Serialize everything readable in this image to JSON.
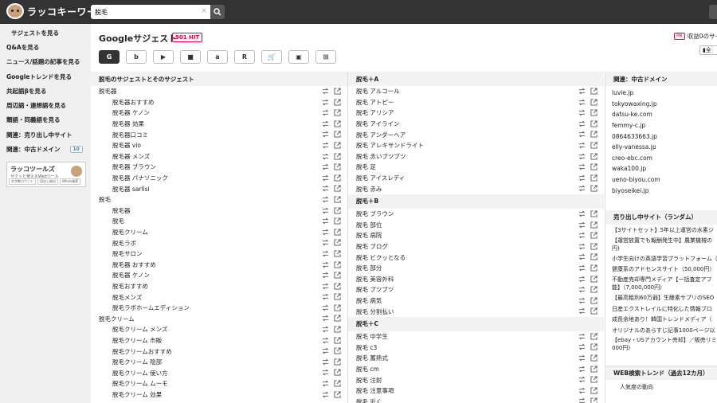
{
  "app": {
    "logo_text": "ラッコキーワード"
  },
  "search": {
    "value": "脱毛",
    "clear": "×"
  },
  "sidebar": {
    "items": [
      "サジェストを見る",
      "Q&Aを見る",
      "ニュース/話題の記事を見る",
      "Googleトレンドを見る",
      "共起語βを見る",
      "周辺語・連想語を見る",
      "類語・同義語を見る",
      "関連：売り出し中サイト",
      "関連：中古ドメイン"
    ],
    "domain_badge": "10",
    "banner": {
      "title": "ラッコツールズ",
      "sub": "サクッと使えるWebツール",
      "tags": [
        "文字数カウント",
        "見出し抽出",
        "Whois検索"
      ]
    }
  },
  "main": {
    "title": "Googleサジェスト",
    "hit": "901 HIT",
    "pr": "PR",
    "revenue": "収益0のサイ",
    "copy": "全"
  },
  "engines": [
    {
      "label": "G",
      "icon": "google-icon"
    },
    {
      "label": "b",
      "icon": "bing-icon"
    },
    {
      "label": "▶",
      "icon": "youtube-icon"
    },
    {
      "label": "■",
      "icon": "video-icon"
    },
    {
      "label": "a",
      "icon": "amazon-icon"
    },
    {
      "label": "R",
      "icon": "rakuten-icon"
    },
    {
      "label": "🛒",
      "icon": "cart-icon"
    },
    {
      "label": "▣",
      "icon": "image-icon"
    },
    {
      "label": "⊞",
      "icon": "app-icon"
    }
  ],
  "col1": {
    "header": "脱毛のサジェストとそのサジェスト",
    "groups": [
      {
        "root": "脱毛器",
        "items": [
          "脱毛器おすすめ",
          "脱毛器 ケノン",
          "脱毛器 効果",
          "脱毛器口コミ",
          "脱毛器 vio",
          "脱毛器 メンズ",
          "脱毛器 ブラウン",
          "脱毛器 パナソニック",
          "脱毛器 sarlisi"
        ]
      },
      {
        "root": "脱毛",
        "items": [
          "脱毛器",
          "脱毛",
          "脱毛クリーム",
          "脱毛ラボ",
          "脱毛サロン",
          "脱毛器 おすすめ",
          "脱毛器 ケノン",
          "脱毛おすすめ",
          "脱毛メンズ",
          "脱毛ラボホームエディション"
        ]
      },
      {
        "root": "脱毛クリーム",
        "items": [
          "脱毛クリーム メンズ",
          "脱毛クリーム 市販",
          "脱毛クリームおすすめ",
          "脱毛クリーム 陰部",
          "脱毛クリーム 使い方",
          "脱毛クリーム ムーモ",
          "脱毛クリーム 効果"
        ]
      }
    ]
  },
  "col2": {
    "sections": [
      {
        "header": "脱毛＋A",
        "items": [
          "脱毛 アルコール",
          "脱毛 アトピー",
          "脱毛 アリシア",
          "脱毛 アイライン",
          "脱毛 アンダーヘア",
          "脱毛 アレキサンドライト",
          "脱毛 赤いブツブツ",
          "脱毛 足",
          "脱毛 アイスレディ",
          "脱毛 赤み"
        ]
      },
      {
        "header": "脱毛＋B",
        "items": [
          "脱毛 ブラウン",
          "脱毛 部位",
          "脱毛 病院",
          "脱毛 ブログ",
          "脱毛 ビクッとなる",
          "脱毛 部分",
          "脱毛 美容外科",
          "脱毛 ブツブツ",
          "脱毛 病気",
          "脱毛 分割払い"
        ]
      },
      {
        "header": "脱毛＋C",
        "items": [
          "脱毛 中学生",
          "脱毛 c3",
          "脱毛 蓄熱式",
          "脱毛 cm",
          "脱毛 注射",
          "脱毛 注意事項",
          "脱毛 近く"
        ]
      }
    ]
  },
  "col3": {
    "domain_header": "関連：中古ドメイン",
    "domains": [
      "luvie.jp",
      "tokyowaxing.jp",
      "datsu-ke.com",
      "femmy-c.jp",
      "0864633663.jp",
      "elly-vanessa.jp",
      "creo-ebc.com",
      "waka100.jp",
      "ueno-biyou.com",
      "biyoseikei.jp"
    ],
    "sale_header": "売り出し中サイト（ランダム）",
    "sales": [
      [
        "【3サイトセット】5年以上運営の水素ジ"
      ],
      [
        "【運営放置でも報酬発生中】農業機械の",
        "円)"
      ],
      [
        "小学生向けの英語学習プラットフォーム（"
      ],
      [
        "健康系のアドセンスサイト（50,000円）"
      ],
      [
        "不動産売却専門メディア【一括査定アフ",
        "能】（7,000,000円）"
      ],
      [
        "【最高粗利60万弱】生酵素サプリのSEO"
      ],
      [
        "日産エクストレイルに特化した情報ブロ"
      ],
      [
        "成長余地あり！韓国トレンドメディア（"
      ],
      [
        "オリジナルのあらすじ記事1000ページ以"
      ],
      [
        "【ebay・USアカウント売却】／販売リミ",
        "000円)"
      ]
    ],
    "trend_header": "WEB検索トレンド（過去12カ月）",
    "trend_item": "人気度の動向"
  }
}
